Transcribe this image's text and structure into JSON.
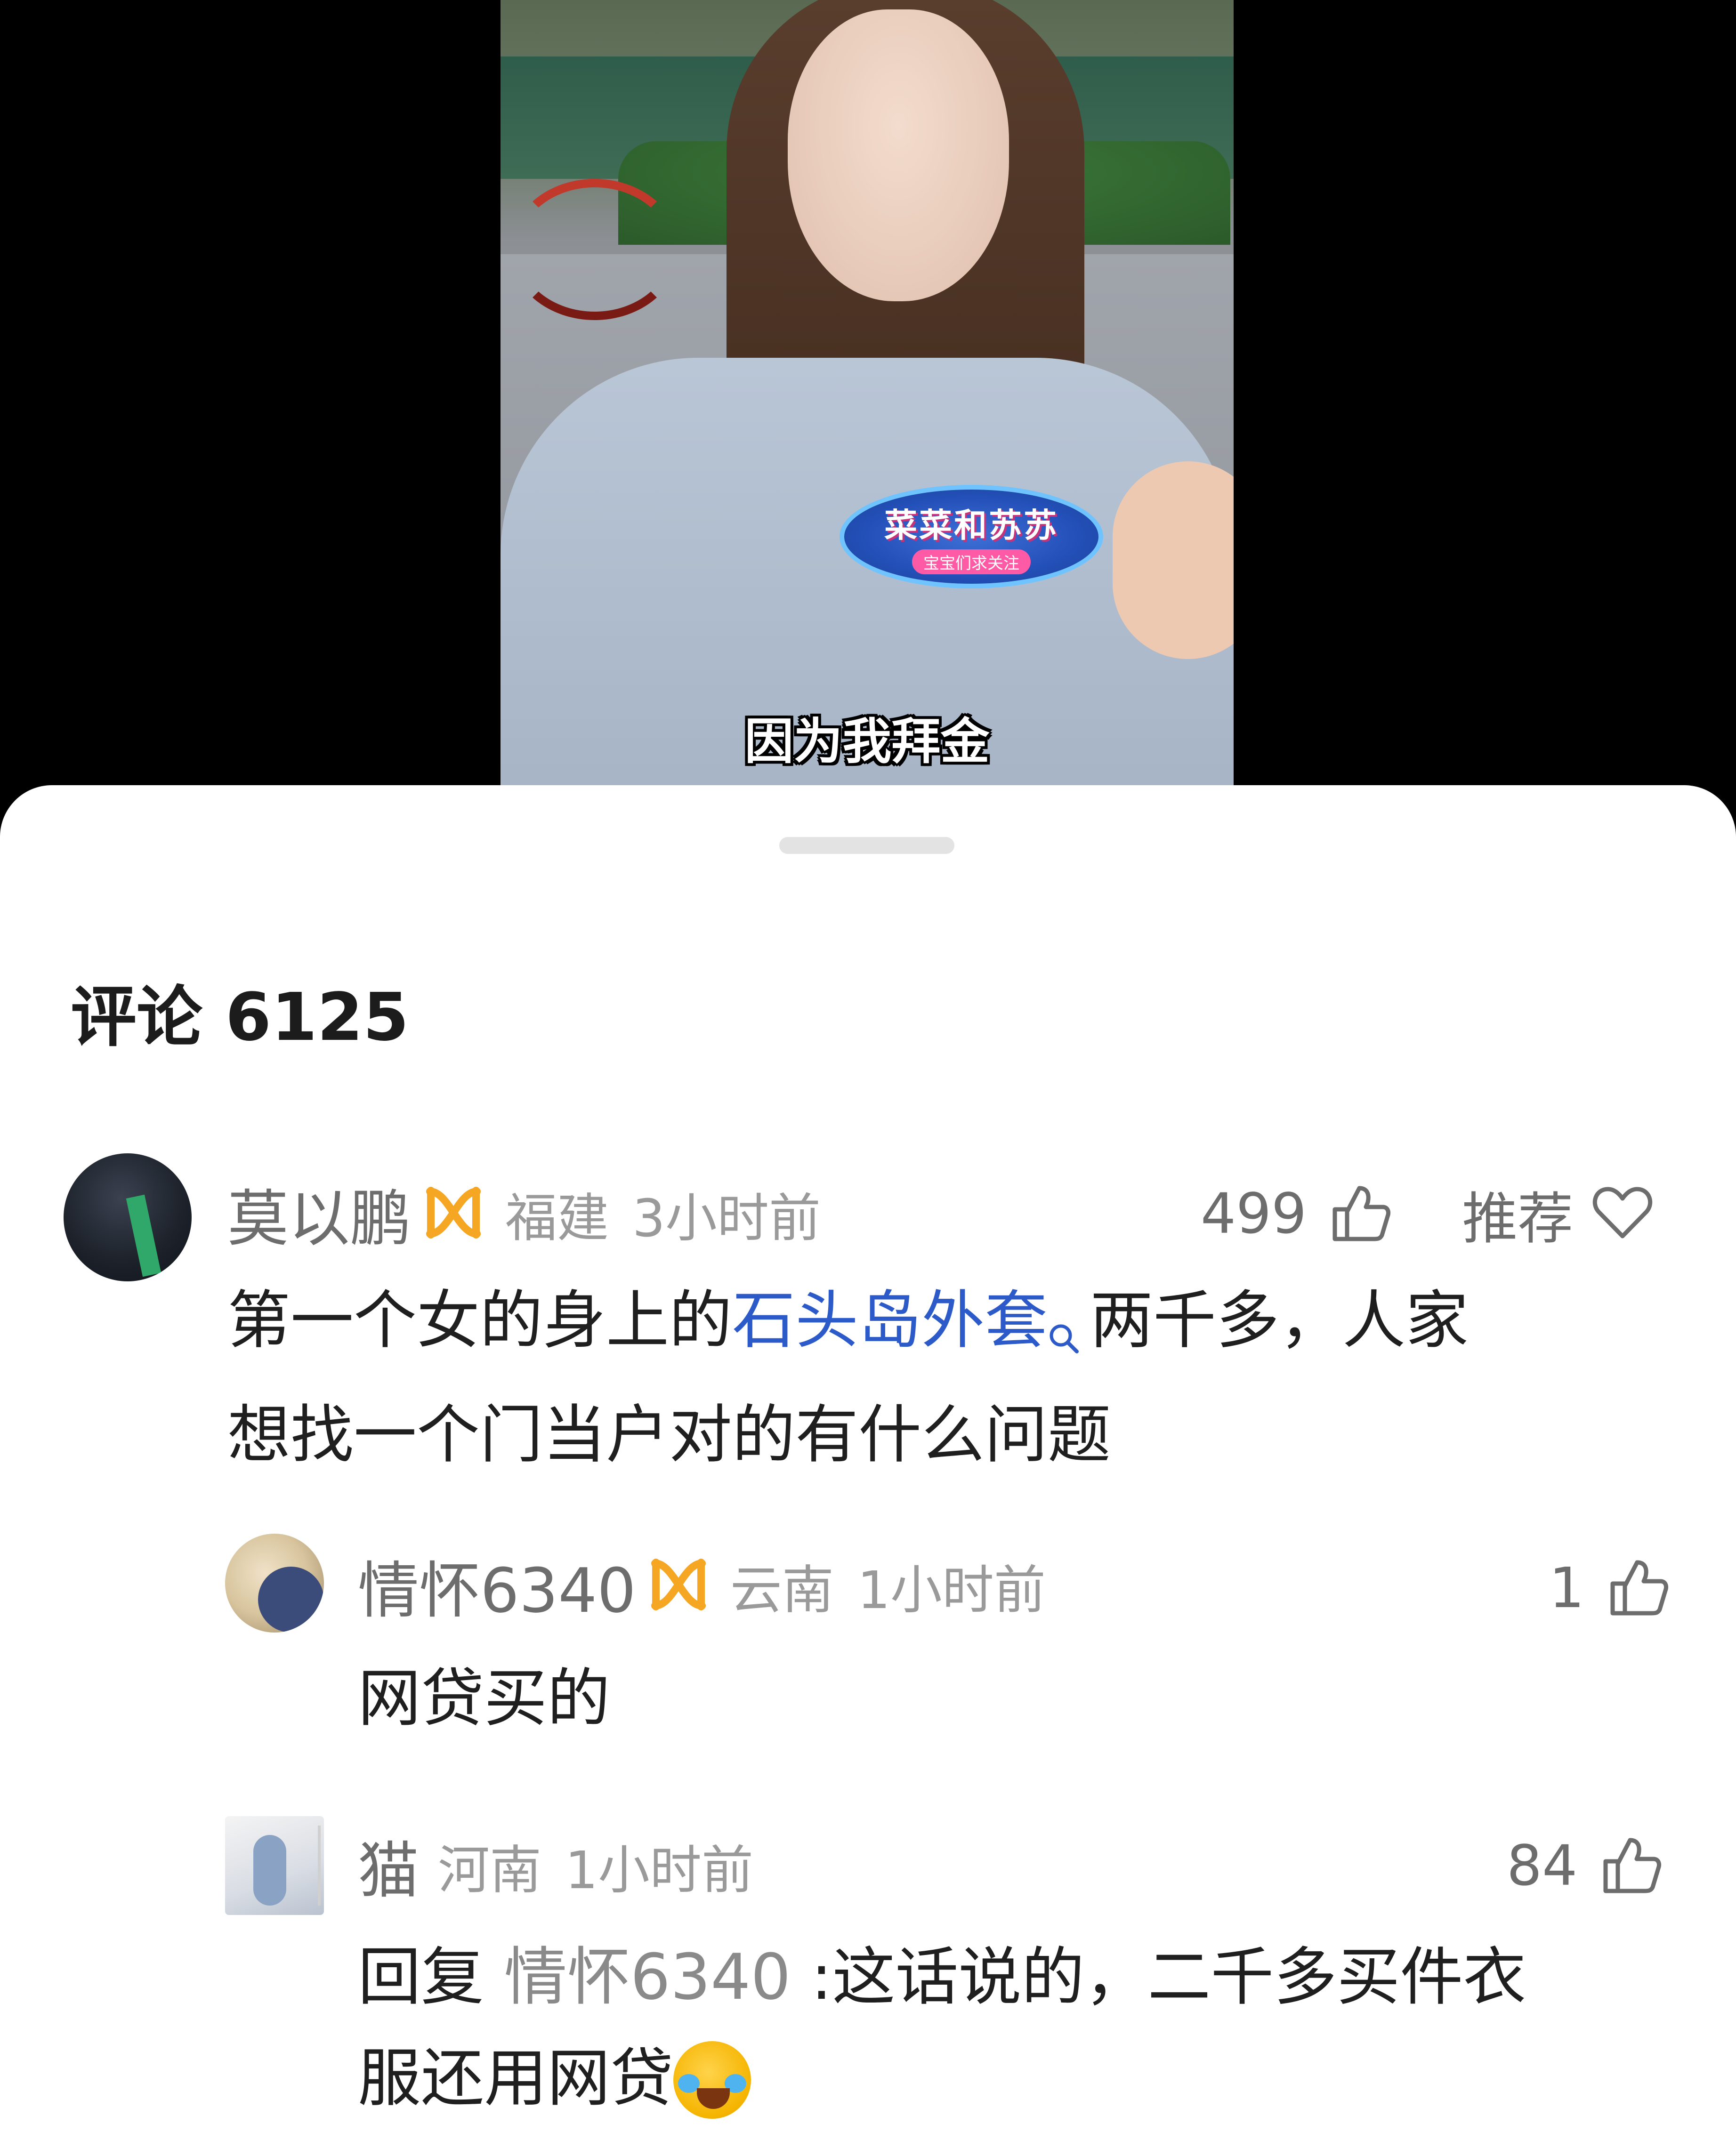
{
  "video": {
    "subtitle": "因为我拜金",
    "badge_title": "菜菜和苏苏",
    "badge_sub": "宝宝们求关注"
  },
  "comments_header": {
    "title": "评论 6125"
  },
  "comments": [
    {
      "username": "莫以鹏",
      "location": "福建",
      "time": "3小时前",
      "likes": "499",
      "recommend_label": "推荐",
      "text_before": "第一个女的身上的",
      "link": "石头岛外套",
      "text_after": "两千多，人家",
      "text_line2": "想找一个门当户对的有什么问题"
    },
    {
      "username": "情怀6340",
      "location": "云南",
      "time": "1小时前",
      "likes": "1",
      "text": "网贷买的"
    },
    {
      "username": "猫",
      "location": "河南",
      "time": "1小时前",
      "likes": "84",
      "reply_prefix": "回复",
      "reply_to": "情怀6340",
      "text_line1": ":这话说的，二千多买件衣",
      "text_line2": "服还用网贷"
    }
  ],
  "icons": {
    "vip": "vip-badge-icon",
    "like": "thumb-up-icon",
    "recommend": "heart-icon",
    "search": "search-icon",
    "emoji": "crying-laughing-emoji-icon"
  },
  "colors": {
    "link": "#2c5ac8",
    "vip_badge": "#f5a623",
    "username": "#6d6d6d",
    "meta": "#9a9a9a"
  }
}
